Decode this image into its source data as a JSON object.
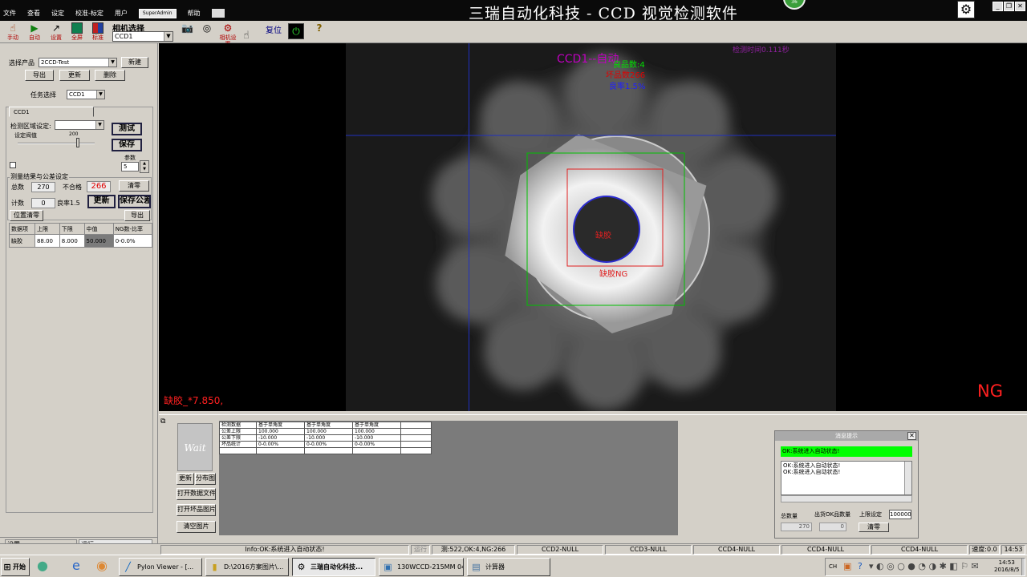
{
  "title_bar": {
    "menu": [
      "文件",
      "查看",
      "设定",
      "校准-标定",
      "用户"
    ],
    "user": "SuperAdmin",
    "help": "帮助",
    "app_title": "三瑞自动化科技 - CCD 视觉检测软件",
    "badge": "36"
  },
  "toolbar": {
    "buttons": [
      {
        "label": "手动",
        "icon": "hand-icon"
      },
      {
        "label": "自动",
        "icon": "play-icon"
      },
      {
        "label": "设置",
        "icon": "wrench-icon"
      },
      {
        "label": "全屏",
        "icon": "fullscreen-icon"
      },
      {
        "label": "标准",
        "icon": "standard-icon"
      }
    ],
    "camera_label": "相机选择",
    "camera_value": "CCD1",
    "camera_settings_label": "相机设置",
    "reset_label": "复位"
  },
  "left_panel": {
    "product_label": "选择产品",
    "product_value": "2CCD-Test",
    "new_btn": "新建",
    "export_btn": "导出",
    "update_btn": "更新",
    "delete_btn": "删除",
    "task_label": "任务选择",
    "task_value": "CCD1",
    "tab_label": "CCD1",
    "region_label": "检测区域设定:",
    "test_btn": "测试",
    "threshold_label": "设定阀值",
    "threshold_value": "200",
    "save_btn": "保存",
    "param_label": "参数",
    "param_value": "5",
    "results_label": "测量结果与公差设定",
    "total_label": "总数",
    "total_value": "270",
    "fail_label": "不合格",
    "fail_value": "266",
    "clear_btn": "清零",
    "count_label": "计数",
    "count_value": "0",
    "yield_label": "良率1.5",
    "update2_btn": "更新",
    "save_tol_btn": "保存公差",
    "pos_clear_btn": "位置清零",
    "export2_btn": "导出",
    "table_headers": [
      "数据项",
      "上限",
      "下限",
      "中值",
      "NG数-比率"
    ],
    "table_row": [
      "缺胶",
      "88.00",
      "8.000",
      "50.000",
      "0-0.0%"
    ]
  },
  "viewer": {
    "title": "CCD1--自动",
    "good_count": "良品数:4",
    "bad_count": "坏品数266",
    "yield": "良率1.5%",
    "detect_time": "检测时间0.111秒",
    "inner_label": "缺胶",
    "defect_label": "缺胶NG",
    "measure_text": "缺胶_*7.850,",
    "result": "NG"
  },
  "bottom_panel": {
    "wait_label": "Wait",
    "buttons": [
      "更新",
      "分布图",
      "打开数据文件",
      "打开坏品图片",
      "清空图片"
    ],
    "table_headers": [
      "检测数据",
      "基于单角度",
      "基于单角度",
      "基于单角度"
    ],
    "table_rows": [
      [
        "公差上限",
        "100.000",
        "100.000",
        "100.000"
      ],
      [
        "公差下限",
        "-10.000",
        "-10.000",
        "-10.000"
      ],
      [
        "坏品统计",
        "0-0.00%",
        "0-0.00%",
        "0-0.00%"
      ]
    ],
    "msg_title": "消息提示",
    "msg_status": "OK:系统进入自动状态!",
    "msg_log": [
      "OK:系统进入自动状态!",
      "OK:系统进入自动状态!"
    ],
    "total_label": "总数量",
    "total_value": "270",
    "ok_label": "出货OK品数量",
    "ok_value": "0",
    "limit_label": "上限设定",
    "limit_value": "100000",
    "clear_btn": "清零"
  },
  "status_bar": {
    "tabs": [
      "设置",
      "运行"
    ],
    "info": "Info:OK:系统进入自动状态!",
    "run": "运行",
    "counts": "测:522,OK:4,NG:266",
    "ccd2": "CCD2-NULL",
    "ccd3": "CCD3-NULL",
    "ccd4a": "CCD4-NULL",
    "ccd4b": "CCD4-NULL",
    "ccd4c": "CCD4-NULL",
    "speed": "速度:0.0",
    "time": "14:53"
  },
  "taskbar": {
    "start": "开始",
    "tasks": [
      "Pylon Viewer - [...",
      "D:\\2016方案图片\\...",
      "三瑞自动化科技...",
      "130WCCD-215MM 04...",
      "计算器"
    ],
    "clock_time": "14:53",
    "clock_date": "2016/8/5",
    "lang": "CH"
  },
  "colors": {
    "viewer_title": "#c000c0",
    "good": "#00e000",
    "bad": "#e00000",
    "yield": "#2020ff",
    "ng": "#ff2020",
    "roi_outer": "#00c000",
    "roi_inner": "#e02020",
    "crosshair": "#2030c0",
    "msg_ok": "#00ff00"
  }
}
